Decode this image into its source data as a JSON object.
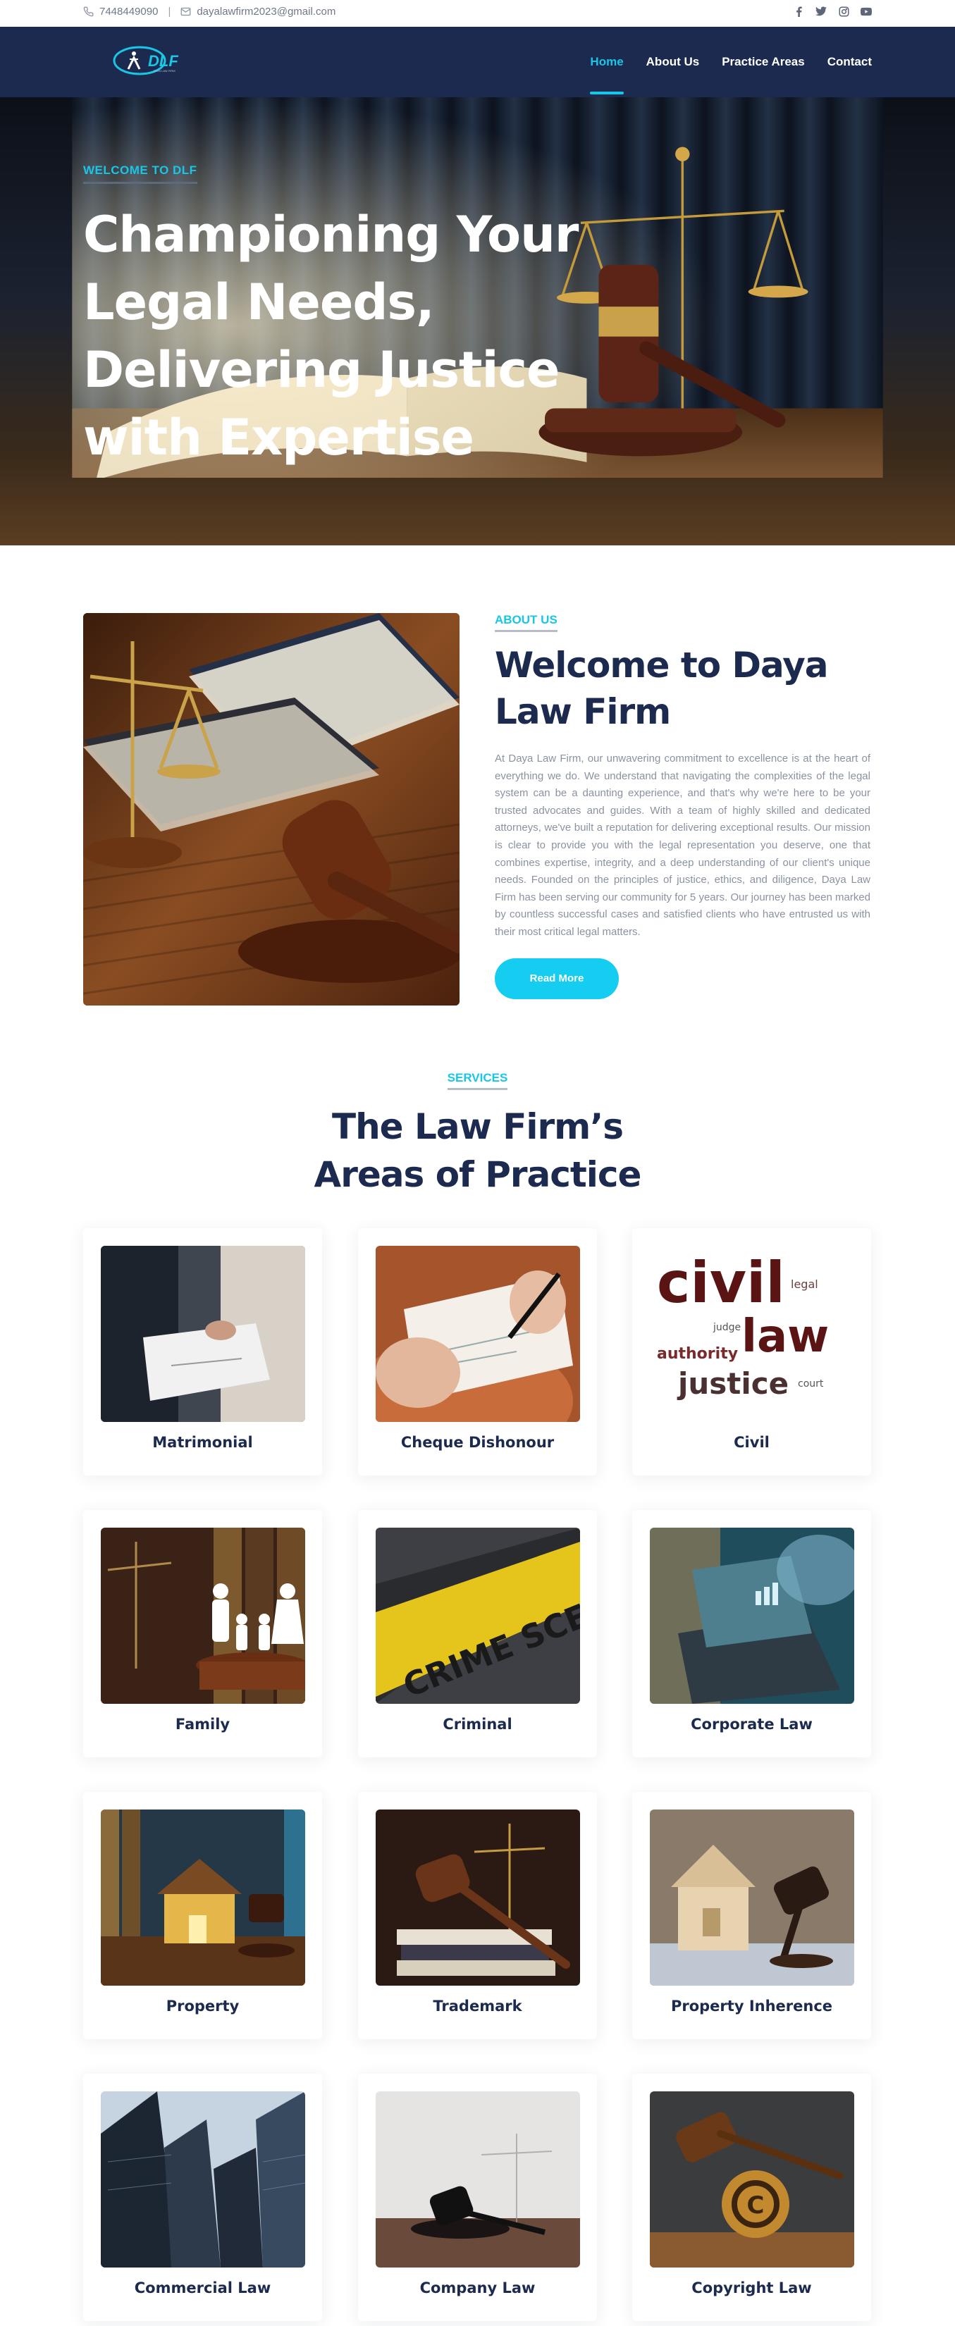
{
  "topbar": {
    "phone": "7448449090",
    "separator": "|",
    "email": "dayalawfirm2023@gmail.com",
    "social": [
      "facebook-icon",
      "twitter-icon",
      "instagram-icon",
      "youtube-icon"
    ]
  },
  "nav": {
    "logo_text": "DLF",
    "logo_tagline": "DAYA LAW FIRM",
    "items": [
      {
        "label": "Home",
        "active": true
      },
      {
        "label": "About Us",
        "active": false
      },
      {
        "label": "Practice Areas",
        "active": false
      },
      {
        "label": "Contact",
        "active": false
      }
    ]
  },
  "hero": {
    "eyebrow": "WELCOME TO DLF",
    "title": "Championing Your Legal Needs, Delivering Justice with Expertise"
  },
  "about": {
    "eyebrow": "ABOUT US",
    "title": "Welcome to Daya Law Firm",
    "paragraph": "At Daya Law Firm, our unwavering commitment to excellence is at the heart of everything we do. We understand that navigating the complexities of the legal system can be a daunting experience, and that's why we're here to be your trusted advocates and guides. With a team of highly skilled and dedicated attorneys, we've built a reputation for delivering exceptional results. Our mission is clear to provide you with the legal representation you deserve, one that combines expertise, integrity, and a deep understanding of our client's unique needs. Founded on the principles of justice, ethics, and diligence, Daya Law Firm has been serving our community for 5 years. Our journey has been marked by countless successful cases and satisfied clients who have entrusted us with their most critical legal matters.",
    "button": "Read More"
  },
  "services": {
    "eyebrow": "SERVICES",
    "title": "The Law Firm’s Areas of Practice",
    "cards": [
      {
        "label": "Matrimonial"
      },
      {
        "label": "Cheque Dishonour"
      },
      {
        "label": "Civil"
      },
      {
        "label": "Family"
      },
      {
        "label": "Criminal"
      },
      {
        "label": "Corporate Law"
      },
      {
        "label": "Property"
      },
      {
        "label": "Trademark"
      },
      {
        "label": "Property Inherence"
      },
      {
        "label": "Commercial Law"
      },
      {
        "label": "Company Law"
      },
      {
        "label": "Copyright Law"
      }
    ]
  },
  "colors": {
    "navy": "#1b2a4e",
    "accent": "#19c6e6"
  }
}
